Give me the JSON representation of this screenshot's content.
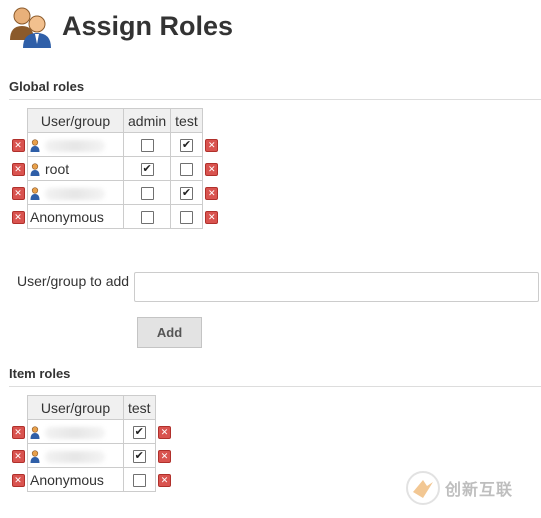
{
  "page": {
    "title": "Assign Roles"
  },
  "global_roles": {
    "heading": "Global roles",
    "columns": [
      "User/group",
      "admin",
      "test"
    ],
    "rows": [
      {
        "name": "",
        "blurred": true,
        "user_icon": true,
        "admin": false,
        "test": true
      },
      {
        "name": "root",
        "blurred": false,
        "user_icon": true,
        "admin": true,
        "test": false
      },
      {
        "name": "",
        "blurred": true,
        "user_icon": true,
        "admin": false,
        "test": true
      },
      {
        "name": "Anonymous",
        "blurred": false,
        "user_icon": false,
        "admin": false,
        "test": false
      }
    ]
  },
  "add_user": {
    "label": "User/group to add",
    "value": "",
    "button_label": "Add"
  },
  "item_roles": {
    "heading": "Item roles",
    "columns": [
      "User/group",
      "test"
    ],
    "rows": [
      {
        "name": "",
        "blurred": true,
        "user_icon": true,
        "test": true
      },
      {
        "name": "",
        "blurred": true,
        "user_icon": true,
        "test": true
      },
      {
        "name": "Anonymous",
        "blurred": false,
        "user_icon": false,
        "test": false
      }
    ]
  },
  "watermark": {
    "text": "创新互联"
  },
  "colors": {
    "delete_red": "#d9534f",
    "border": "#cccccc",
    "header_bg": "#f0f0f0"
  },
  "icons": {
    "title": "users-icon",
    "delete": "delete-x-icon",
    "user": "user-icon"
  }
}
